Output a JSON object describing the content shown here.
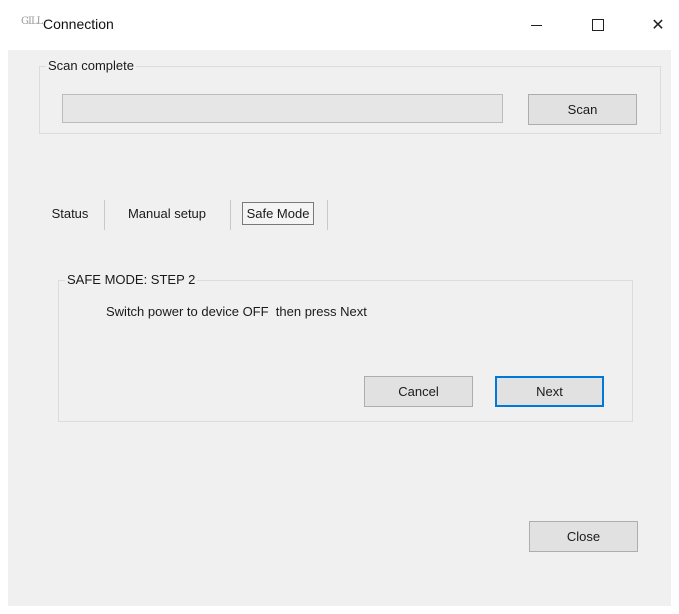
{
  "window": {
    "icon_text": "GILL",
    "title": "Connection",
    "minimize_icon": "minimize-icon",
    "maximize_icon": "maximize-icon",
    "close_glyph": "✕"
  },
  "scan": {
    "group_label": "Scan complete",
    "progress": 0,
    "button_label": "Scan"
  },
  "tabs": [
    {
      "label": "Status",
      "selected": false
    },
    {
      "label": "Manual setup",
      "selected": false
    },
    {
      "label": "Safe Mode",
      "selected": true
    }
  ],
  "safe_mode": {
    "group_label": "SAFE MODE: STEP 2",
    "instruction": "Switch power to device OFF  then press Next",
    "cancel_label": "Cancel",
    "next_label": "Next"
  },
  "footer": {
    "close_label": "Close"
  },
  "colors": {
    "accent_focus": "#0078d7",
    "window_bg": "#f0f0f0",
    "button_bg": "#e1e1e1"
  }
}
